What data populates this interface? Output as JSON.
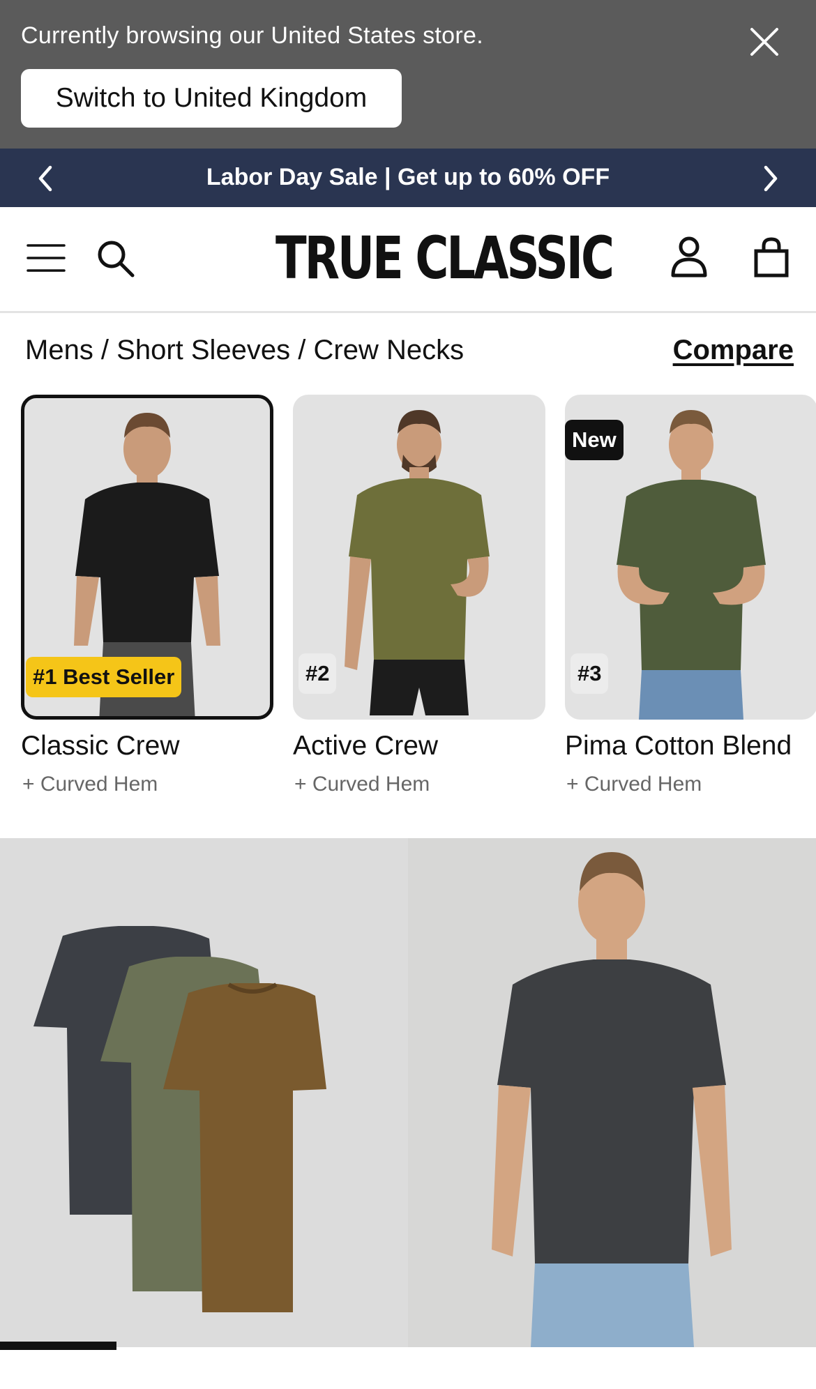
{
  "store_banner": {
    "message": "Currently browsing our United States store.",
    "switch_label": "Switch to United Kingdom",
    "bg_color": "#5b5b5b"
  },
  "promo": {
    "text": "Labor Day Sale | Get up to 60% OFF",
    "bg_color": "#2a3551"
  },
  "header": {
    "logo": "TRUE CLASSIC",
    "icons": [
      "menu-icon",
      "search-icon",
      "account-icon",
      "cart-icon"
    ]
  },
  "breadcrumb": {
    "path": "Mens / Short Sleeves / Crew Necks",
    "compare_label": "Compare"
  },
  "products": [
    {
      "badge": "#1 Best Seller",
      "name": "Classic Crew",
      "subtitle": "+ Curved Hem",
      "shirt_color": "#1b1b1b"
    },
    {
      "badge": "#2",
      "name": "Active Crew",
      "subtitle": "+ Curved Hem",
      "shirt_color": "#6e6f3a"
    },
    {
      "badge": "New",
      "badge2": "#3",
      "name": "Pima Cotton Blend",
      "subtitle": "+ Curved Hem",
      "shirt_color": "#4f5c3b"
    }
  ],
  "hero": {
    "left_shirt_colors": [
      "#3c3f45",
      "#6b7256",
      "#7a5a2e"
    ],
    "right_shirt_color": "#3d3f42",
    "slider_progress": 0.14
  }
}
